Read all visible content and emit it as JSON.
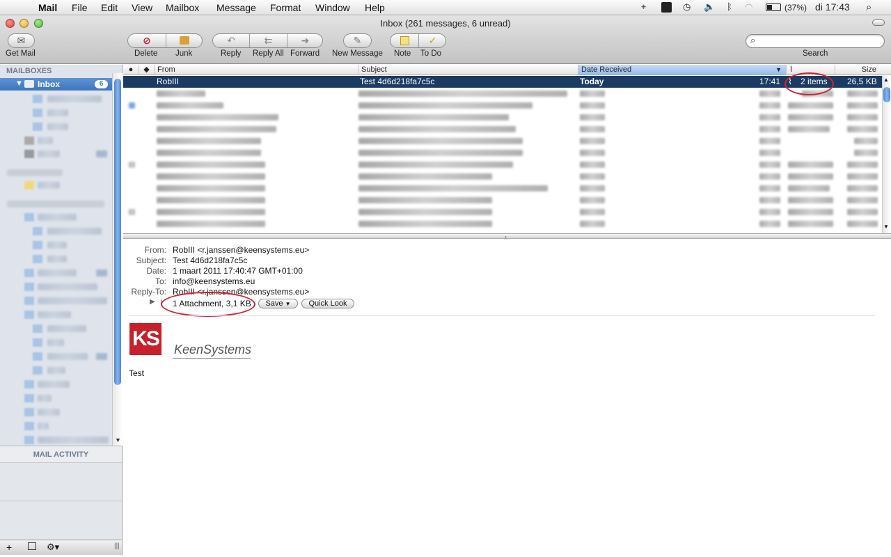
{
  "menubar": {
    "items": [
      "Mail",
      "File",
      "Edit",
      "View",
      "Mailbox",
      "Message",
      "Format",
      "Window",
      "Help"
    ],
    "battery": "(37%)",
    "clock": "di 17:43"
  },
  "window": {
    "title": "Inbox (261 messages, 6 unread)"
  },
  "toolbar": {
    "get_mail": "Get Mail",
    "delete": "Delete",
    "junk": "Junk",
    "reply": "Reply",
    "reply_all": "Reply All",
    "forward": "Forward",
    "new_message": "New Message",
    "note": "Note",
    "todo": "To Do",
    "search_label": "Search",
    "search_placeholder": ""
  },
  "sidebar": {
    "header": "MAILBOXES",
    "inbox_label": "Inbox",
    "inbox_count": "6",
    "activity_header": "MAIL ACTIVITY"
  },
  "list": {
    "columns": {
      "from": "From",
      "subject": "Subject",
      "date": "Date Received",
      "size": "Size"
    },
    "selected": {
      "from": "RobIII",
      "subject": "Test 4d6d218fa7c5c",
      "date": "Today",
      "time": "17:41",
      "attachments": "2 items",
      "size": "26,5 KB"
    }
  },
  "message": {
    "labels": {
      "from": "From:",
      "subject": "Subject:",
      "date": "Date:",
      "to": "To:",
      "reply_to": "Reply-To:"
    },
    "from": "RobIII <r.janssen@keensystems.eu>",
    "subject": "Test 4d6d218fa7c5c",
    "date": "1 maart 2011 17:40:47 GMT+01:00",
    "to": "info@keensystems.eu",
    "reply_to": "RobIII <r.janssen@keensystems.eu>",
    "attachment_summary": "1 Attachment, 3,1 KB",
    "save_label": "Save",
    "quicklook_label": "Quick Look",
    "logo_mark": "KS",
    "logo_text": "KeenSystems",
    "body": "Test"
  },
  "colors": {
    "selection": "#1c3b63",
    "sidebar_selection": "#4a82c8",
    "annotation": "#d8202e",
    "logo_red": "#c8202a"
  }
}
